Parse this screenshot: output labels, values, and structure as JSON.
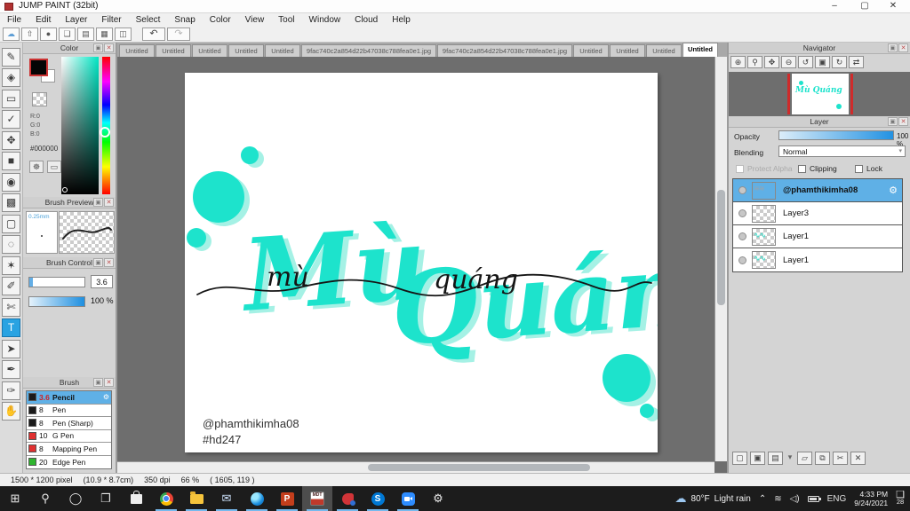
{
  "window": {
    "title": "JUMP PAINT (32bit)",
    "controls": {
      "minimize": "–",
      "maximize": "▢",
      "close": "✕"
    }
  },
  "menu": {
    "items": [
      "File",
      "Edit",
      "Layer",
      "Filter",
      "Select",
      "Snap",
      "Color",
      "View",
      "Tool",
      "Window",
      "Cloud",
      "Help"
    ]
  },
  "toolbar": {
    "buttons": [
      {
        "name": "cloud",
        "glyph": "☁"
      },
      {
        "name": "publish",
        "glyph": "⇧"
      },
      {
        "name": "comment",
        "glyph": "●"
      },
      {
        "name": "message",
        "glyph": "❏"
      },
      {
        "name": "document",
        "glyph": "▤"
      },
      {
        "name": "panel-layout",
        "glyph": "▦"
      },
      {
        "name": "palette",
        "glyph": "◫"
      }
    ],
    "undo": "↶",
    "redo": "↷"
  },
  "tabs": {
    "items": [
      {
        "label": "Untitled"
      },
      {
        "label": "Untitled"
      },
      {
        "label": "Untitled"
      },
      {
        "label": "Untitled"
      },
      {
        "label": "Untitled"
      },
      {
        "label": "9fac740c2a854d22b47038c788fea0e1.jpg"
      },
      {
        "label": "9fac740c2a854d22b47038c788fea0e1.jpg"
      },
      {
        "label": "Untitled"
      },
      {
        "label": "Untitled"
      },
      {
        "label": "Untitled"
      },
      {
        "label": "Untitled",
        "active": true
      }
    ]
  },
  "tools": {
    "items": [
      {
        "name": "brush",
        "glyph": "✎"
      },
      {
        "name": "eraser",
        "glyph": "◈"
      },
      {
        "name": "shape",
        "glyph": "▭"
      },
      {
        "name": "polyline",
        "glyph": "✓"
      },
      {
        "name": "move",
        "glyph": "✥"
      },
      {
        "name": "fill-rect",
        "glyph": "■"
      },
      {
        "name": "bucket",
        "glyph": "◉"
      },
      {
        "name": "gradient",
        "glyph": "▩"
      },
      {
        "name": "select-rect",
        "glyph": "▢"
      },
      {
        "name": "lasso",
        "glyph": "◌"
      },
      {
        "name": "magic-wand",
        "glyph": "✶"
      },
      {
        "name": "select-pen",
        "glyph": "✐"
      },
      {
        "name": "select-eraser",
        "glyph": "✄"
      },
      {
        "name": "text",
        "glyph": "T",
        "active": true
      },
      {
        "name": "object-select",
        "glyph": "➤"
      },
      {
        "name": "divide",
        "glyph": "✒"
      },
      {
        "name": "eyedropper",
        "glyph": "✑"
      },
      {
        "name": "hand",
        "glyph": "✋"
      }
    ]
  },
  "panel_buttons": {
    "popout": "▣",
    "close": "✕"
  },
  "color_panel": {
    "title": "Color",
    "r": "R:0",
    "g": "G:0",
    "b": "B:0",
    "hex": "#000000",
    "palette_btn": "☸",
    "slot_btn": "▭"
  },
  "brush_preview": {
    "title": "Brush Preview",
    "size": "0.25mm"
  },
  "brush_control": {
    "title": "Brush Control",
    "size_value": "3.6",
    "opacity_value": "100 %"
  },
  "brush_panel": {
    "title": "Brush",
    "brushes": [
      {
        "size": "3.6",
        "name": "Pencil",
        "color": "#1a1a1a",
        "selected": true
      },
      {
        "size": "8",
        "name": "Pen",
        "color": "#1a1a1a"
      },
      {
        "size": "8",
        "name": "Pen (Sharp)",
        "color": "#1a1a1a"
      },
      {
        "size": "10",
        "name": "G Pen",
        "color": "#e03030"
      },
      {
        "size": "8",
        "name": "Mapping Pen",
        "color": "#e03030"
      },
      {
        "size": "20",
        "name": "Edge Pen",
        "color": "#2fb52f"
      }
    ],
    "gear": "⚙",
    "footer_buttons": [
      {
        "name": "upload-brush",
        "glyph": "⇧"
      },
      {
        "name": "new-brush",
        "glyph": "▢"
      },
      {
        "name": "duplicate-brush",
        "glyph": "⧉"
      },
      {
        "name": "brush-script",
        "glyph": "s"
      }
    ]
  },
  "navigator": {
    "title": "Navigator",
    "buttons": [
      {
        "name": "zoom-in",
        "glyph": "⊕"
      },
      {
        "name": "zoom-tool",
        "glyph": "⚲"
      },
      {
        "name": "fit-screen",
        "glyph": "✥"
      },
      {
        "name": "zoom-out",
        "glyph": "⊖"
      },
      {
        "name": "rotate-ccw",
        "glyph": "↺"
      },
      {
        "name": "reset-view",
        "glyph": "▣"
      },
      {
        "name": "rotate-cw",
        "glyph": "↻"
      },
      {
        "name": "flip",
        "glyph": "⇄"
      }
    ]
  },
  "layer_panel": {
    "title": "Layer",
    "opacity_label": "Opacity",
    "opacity_value": "100 %",
    "blending_label": "Blending",
    "blending_value": "Normal",
    "blend_arrow": "▾",
    "protect_alpha": "Protect Alpha",
    "clipping": "Clipping",
    "lock": "Lock",
    "layers": [
      {
        "name": "@phamthikimha08",
        "selected": true
      },
      {
        "name": "Layer3"
      },
      {
        "name": "Layer1"
      },
      {
        "name": "Layer1"
      }
    ],
    "gear": "⚙",
    "footer_buttons": [
      {
        "name": "new-layer",
        "glyph": "▢"
      },
      {
        "name": "new-8bit-layer",
        "glyph": "▣"
      },
      {
        "name": "new-1bit-layer",
        "glyph": "▤"
      },
      {
        "name": "layer-type-dropdown",
        "glyph": "▾"
      },
      {
        "name": "new-folder",
        "glyph": "▱"
      },
      {
        "name": "duplicate-layer",
        "glyph": "⧉"
      },
      {
        "name": "merge-layer",
        "glyph": "✂"
      },
      {
        "name": "delete-layer",
        "glyph": "✕"
      }
    ]
  },
  "canvas": {
    "title_word1": "Mù",
    "title_word2": "Quáng",
    "script_word1": "mù",
    "script_word2": "quáng",
    "credit": "@phamthikimha08",
    "hashtag": "#hd247",
    "teal": "#1de3cc",
    "teal_light": "#a5f1e5",
    "ink": "#151515"
  },
  "status": {
    "size": "1500 * 1200 pixel",
    "dimensions": "(10.9 * 8.7cm)",
    "dpi": "350 dpi",
    "zoom": "66 %",
    "coords": "( 1605, 119 )"
  },
  "taskbar": {
    "start": "⊞",
    "search": "⚲",
    "cortana": "◯",
    "taskview": "❐",
    "mail": "✉",
    "settings": "⚙",
    "jump_label": "MDT",
    "weather_icon": "☁",
    "weather_temp": "80°F",
    "weather_desc": "Light rain",
    "chevron": "⌃",
    "wifi": "≋",
    "speaker": "◁)",
    "lang": "ENG",
    "time": "4:33 PM",
    "date": "9/24/2021",
    "notif_icon": "❑",
    "badge": "28"
  }
}
